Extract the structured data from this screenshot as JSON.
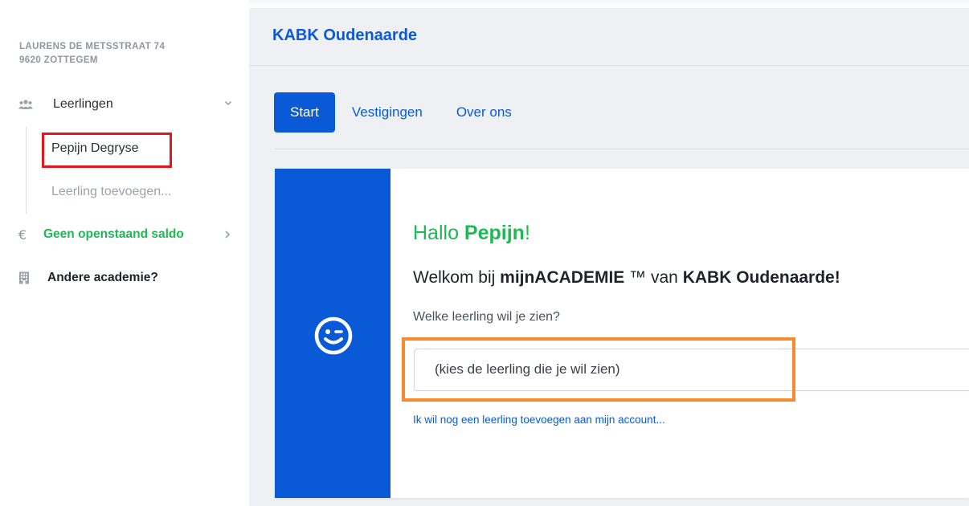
{
  "sidebar": {
    "address_line1": "LAURENS DE METSSTRAAT 74",
    "address_line2": "9620 ZOTTEGEM",
    "students": {
      "label": "Leerlingen",
      "icon": "users-icon",
      "items": [
        {
          "label": "Pepijn Degryse"
        },
        {
          "label": "Leerling toevoegen..."
        }
      ]
    },
    "balance": {
      "icon_glyph": "€",
      "label": "Geen openstaand saldo"
    },
    "other_academy": {
      "label": "Andere academie?",
      "icon": "building-icon"
    }
  },
  "header": {
    "title": "KABK Oudenaarde"
  },
  "tabs": [
    {
      "label": "Start",
      "active": true
    },
    {
      "label": "Vestigingen",
      "active": false
    },
    {
      "label": "Over ons",
      "active": false
    }
  ],
  "card": {
    "greeting_prefix": "Hallo ",
    "greeting_name": "Pepijn",
    "greeting_suffix": "!",
    "welcome_prefix": "Welkom bij ",
    "welcome_brand": "mijnACADEMIE",
    "welcome_tm": " ™ van ",
    "welcome_school": "KABK Oudenaarde",
    "welcome_suffix": "!",
    "question": "Welke leerling wil je zien?",
    "select_value": "(kies de leerling die je wil zien)",
    "add_link": "Ik wil nog een leerling toevoegen aan mijn account..."
  },
  "colors": {
    "brand_blue": "#0a5ad8",
    "success_green": "#1db954",
    "highlight_red": "#e3151e",
    "highlight_orange": "#f68a2d"
  }
}
